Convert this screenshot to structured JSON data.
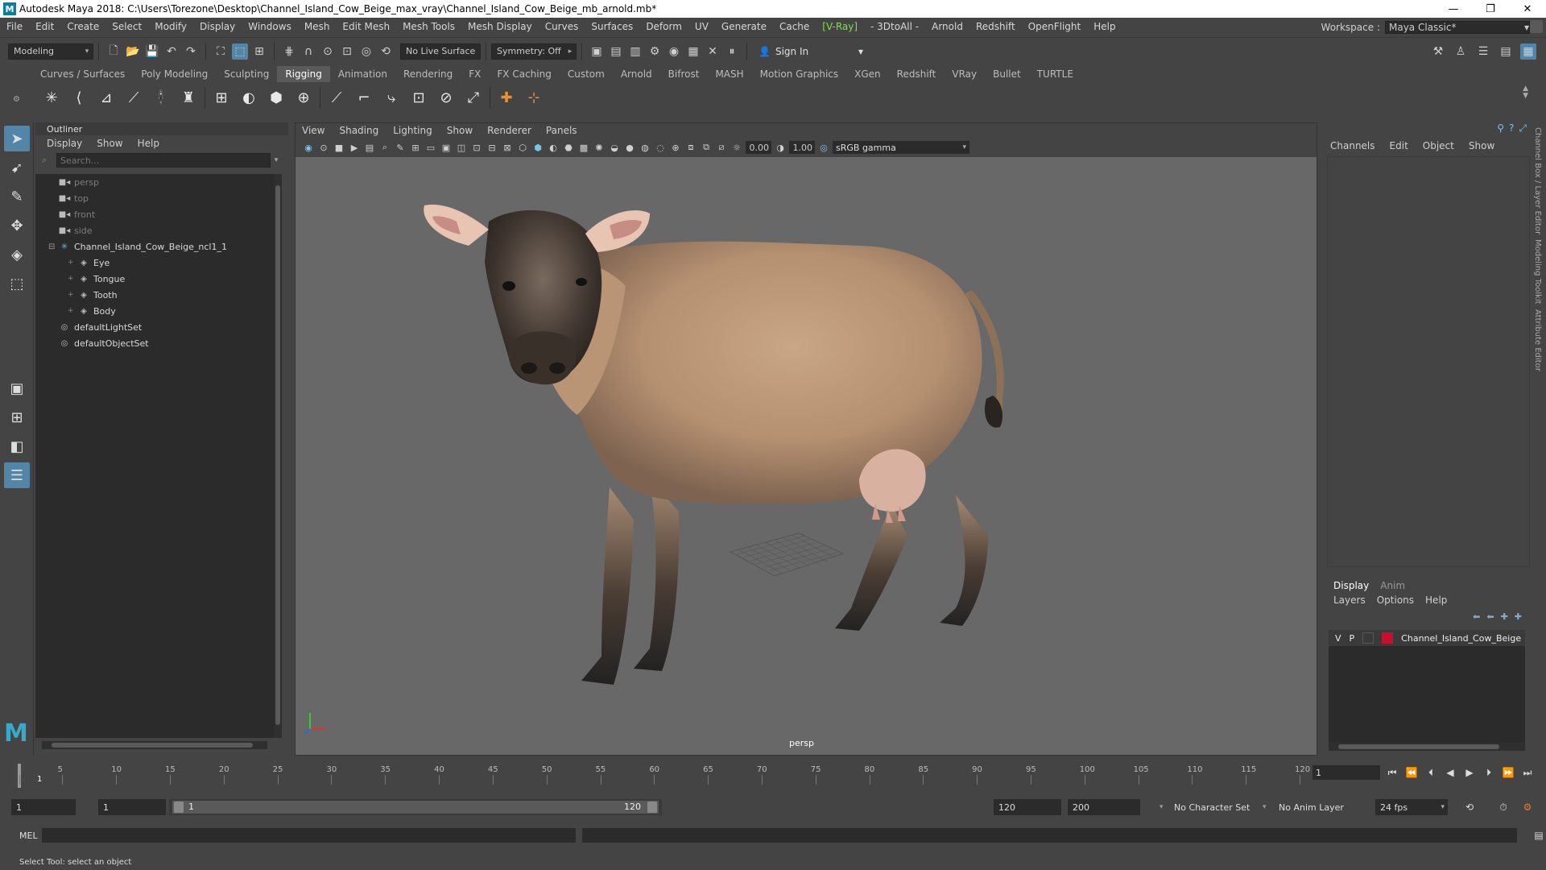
{
  "window": {
    "title": "Autodesk Maya 2018: C:\\Users\\Torezone\\Desktop\\Channel_Island_Cow_Beige_max_vray\\Channel_Island_Cow_Beige_mb_arnold.mb*",
    "logo_letter": "M",
    "minimize": "—",
    "restore": "❐",
    "close": "✕"
  },
  "menubar": {
    "items": [
      "File",
      "Edit",
      "Create",
      "Select",
      "Modify",
      "Display",
      "Windows",
      "Mesh",
      "Edit Mesh",
      "Mesh Tools",
      "Mesh Display",
      "Curves",
      "Surfaces",
      "Deform",
      "UV",
      "Generate",
      "Cache"
    ],
    "vray": "[V-Ray]",
    "items2": [
      "- 3DtoAll -",
      "Arnold",
      "Redshift",
      "OpenFlight",
      "Help"
    ],
    "workspace_label": "Workspace :",
    "workspace_value": "Maya Classic*"
  },
  "statusline": {
    "mode": "Modeling",
    "live_surface": "No Live Surface",
    "symmetry": "Symmetry: Off",
    "sign_in": "Sign In"
  },
  "shelf": {
    "tabs": [
      "Curves / Surfaces",
      "Poly Modeling",
      "Sculpting",
      "Rigging",
      "Animation",
      "Rendering",
      "FX",
      "FX Caching",
      "Custom",
      "Arnold",
      "Bifrost",
      "MASH",
      "Motion Graphics",
      "XGen",
      "Redshift",
      "VRay",
      "Bullet",
      "TURTLE"
    ],
    "active_tab": "Rigging"
  },
  "outliner": {
    "title": "Outliner",
    "menu": [
      "Display",
      "Show",
      "Help"
    ],
    "search_placeholder": "Search...",
    "nodes": [
      {
        "label": "persp",
        "dim": true,
        "indent": 1,
        "icon": "camera-icon"
      },
      {
        "label": "top",
        "dim": true,
        "indent": 1,
        "icon": "camera-icon"
      },
      {
        "label": "front",
        "dim": true,
        "indent": 1,
        "icon": "camera-icon"
      },
      {
        "label": "side",
        "dim": true,
        "indent": 1,
        "icon": "camera-icon"
      },
      {
        "label": "Channel_Island_Cow_Beige_ncl1_1",
        "dim": false,
        "indent": 0,
        "icon": "group-icon"
      },
      {
        "label": "Eye",
        "dim": false,
        "indent": 2,
        "icon": "mesh-icon"
      },
      {
        "label": "Tongue",
        "dim": false,
        "indent": 2,
        "icon": "mesh-icon"
      },
      {
        "label": "Tooth",
        "dim": false,
        "indent": 2,
        "icon": "mesh-icon"
      },
      {
        "label": "Body",
        "dim": false,
        "indent": 2,
        "icon": "mesh-icon"
      },
      {
        "label": "defaultLightSet",
        "dim": false,
        "indent": 1,
        "icon": "set-icon"
      },
      {
        "label": "defaultObjectSet",
        "dim": false,
        "indent": 1,
        "icon": "set-icon"
      }
    ]
  },
  "viewport": {
    "menu": [
      "View",
      "Shading",
      "Lighting",
      "Show",
      "Renderer",
      "Panels"
    ],
    "exposure": "0.00",
    "gamma_value": "1.00",
    "color_space": "sRGB gamma",
    "camera_label": "persp"
  },
  "channelbox": {
    "menu": [
      "Channels",
      "Edit",
      "Object",
      "Show"
    ],
    "side_tabs": [
      "Channel Box / Layer Editor",
      "Modeling Toolkit",
      "Attribute Editor"
    ]
  },
  "layers": {
    "tabs": [
      "Display",
      "Anim"
    ],
    "active_tab": "Display",
    "menu": [
      "Layers",
      "Options",
      "Help"
    ],
    "rows": [
      {
        "v": "V",
        "p": "P",
        "color": "#c8102e",
        "name": "Channel_Island_Cow_Beige"
      }
    ]
  },
  "timeslider": {
    "ticks": [
      "1",
      "5",
      "10",
      "15",
      "20",
      "25",
      "30",
      "35",
      "40",
      "45",
      "50",
      "55",
      "60",
      "65",
      "70",
      "75",
      "80",
      "85",
      "90",
      "95",
      "100",
      "105",
      "110",
      "115",
      "120"
    ],
    "current_frame": "1",
    "frame_field": "1"
  },
  "range": {
    "start": "1",
    "playback_start": "1",
    "slider_start": "1",
    "slider_end": "120",
    "playback_end": "120",
    "end": "200",
    "character_set": "No Character Set",
    "anim_layer": "No Anim Layer",
    "fps": "24 fps"
  },
  "cmdline": {
    "label": "MEL"
  },
  "helpline": {
    "text": "Select Tool: select an object"
  }
}
